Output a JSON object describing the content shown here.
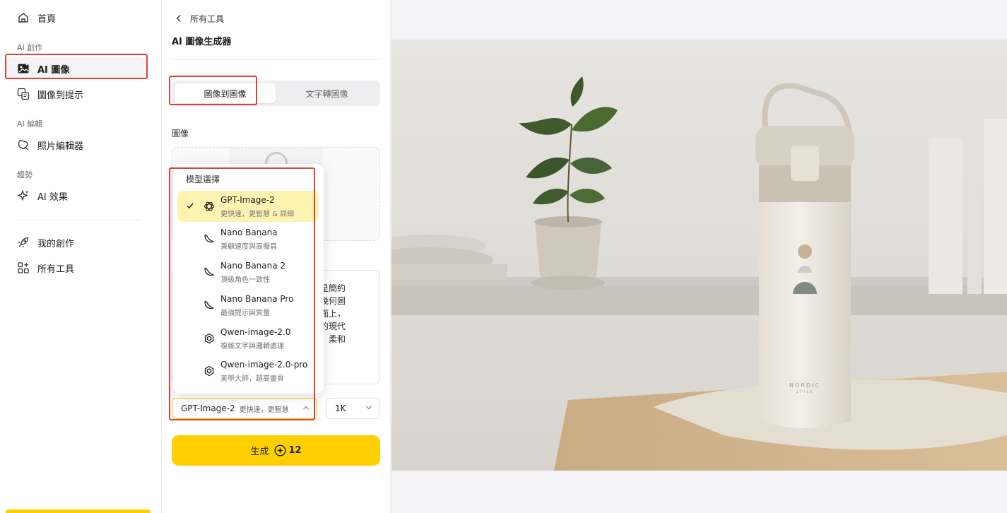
{
  "sidebar": {
    "home": "首頁",
    "section_create": "AI 創作",
    "ai_image": "AI 圖像",
    "image_to_prompt": "圖像到提示",
    "section_edit": "AI 編輯",
    "photo_editor": "照片編輯器",
    "section_trends": "趨勢",
    "ai_effects": "AI 效果",
    "my_creations": "我的創作",
    "all_tools": "所有工具"
  },
  "panel": {
    "back_label": "所有工具",
    "title": "AI 圖像生成器",
    "tabs": [
      "圖像到圖像",
      "文字轉圖像"
    ],
    "image_label": "圖像",
    "prompt_text": "的是簡約\n有幾何圖\n桌面上，\n風的現代\n植，柔和",
    "model_selected": "GPT-Image-2",
    "model_selected_desc": "更快速，更智慧",
    "resolution": "1K",
    "generate_label": "生成",
    "generate_cost": "12"
  },
  "dropdown": {
    "title": "模型選擇",
    "items": [
      {
        "name": "GPT-Image-2",
        "desc": "更快速，更智慧 & 詳細",
        "icon": "openai-icon",
        "selected": true
      },
      {
        "name": "Nano Banana",
        "desc": "兼顧速度與高擬真",
        "icon": "banana-icon",
        "selected": false
      },
      {
        "name": "Nano Banana 2",
        "desc": "頂級角色一致性",
        "icon": "banana-icon",
        "selected": false
      },
      {
        "name": "Nano Banana Pro",
        "desc": "最強提示與質量",
        "icon": "banana-icon",
        "selected": false
      },
      {
        "name": "Qwen-image-2.0",
        "desc": "複雜文字與邏輯處理",
        "icon": "qwen-icon",
        "selected": false
      },
      {
        "name": "Qwen-image-2.0-pro",
        "desc": "美學大師，超高畫質",
        "icon": "qwen-icon",
        "selected": false
      }
    ]
  },
  "preview": {
    "bottle_brand": "NORDIC",
    "bottle_sub": "STYLE"
  },
  "colors": {
    "accent": "#ffcf00",
    "selected_bg": "#fff3b2",
    "highlight": "#d9433a"
  }
}
